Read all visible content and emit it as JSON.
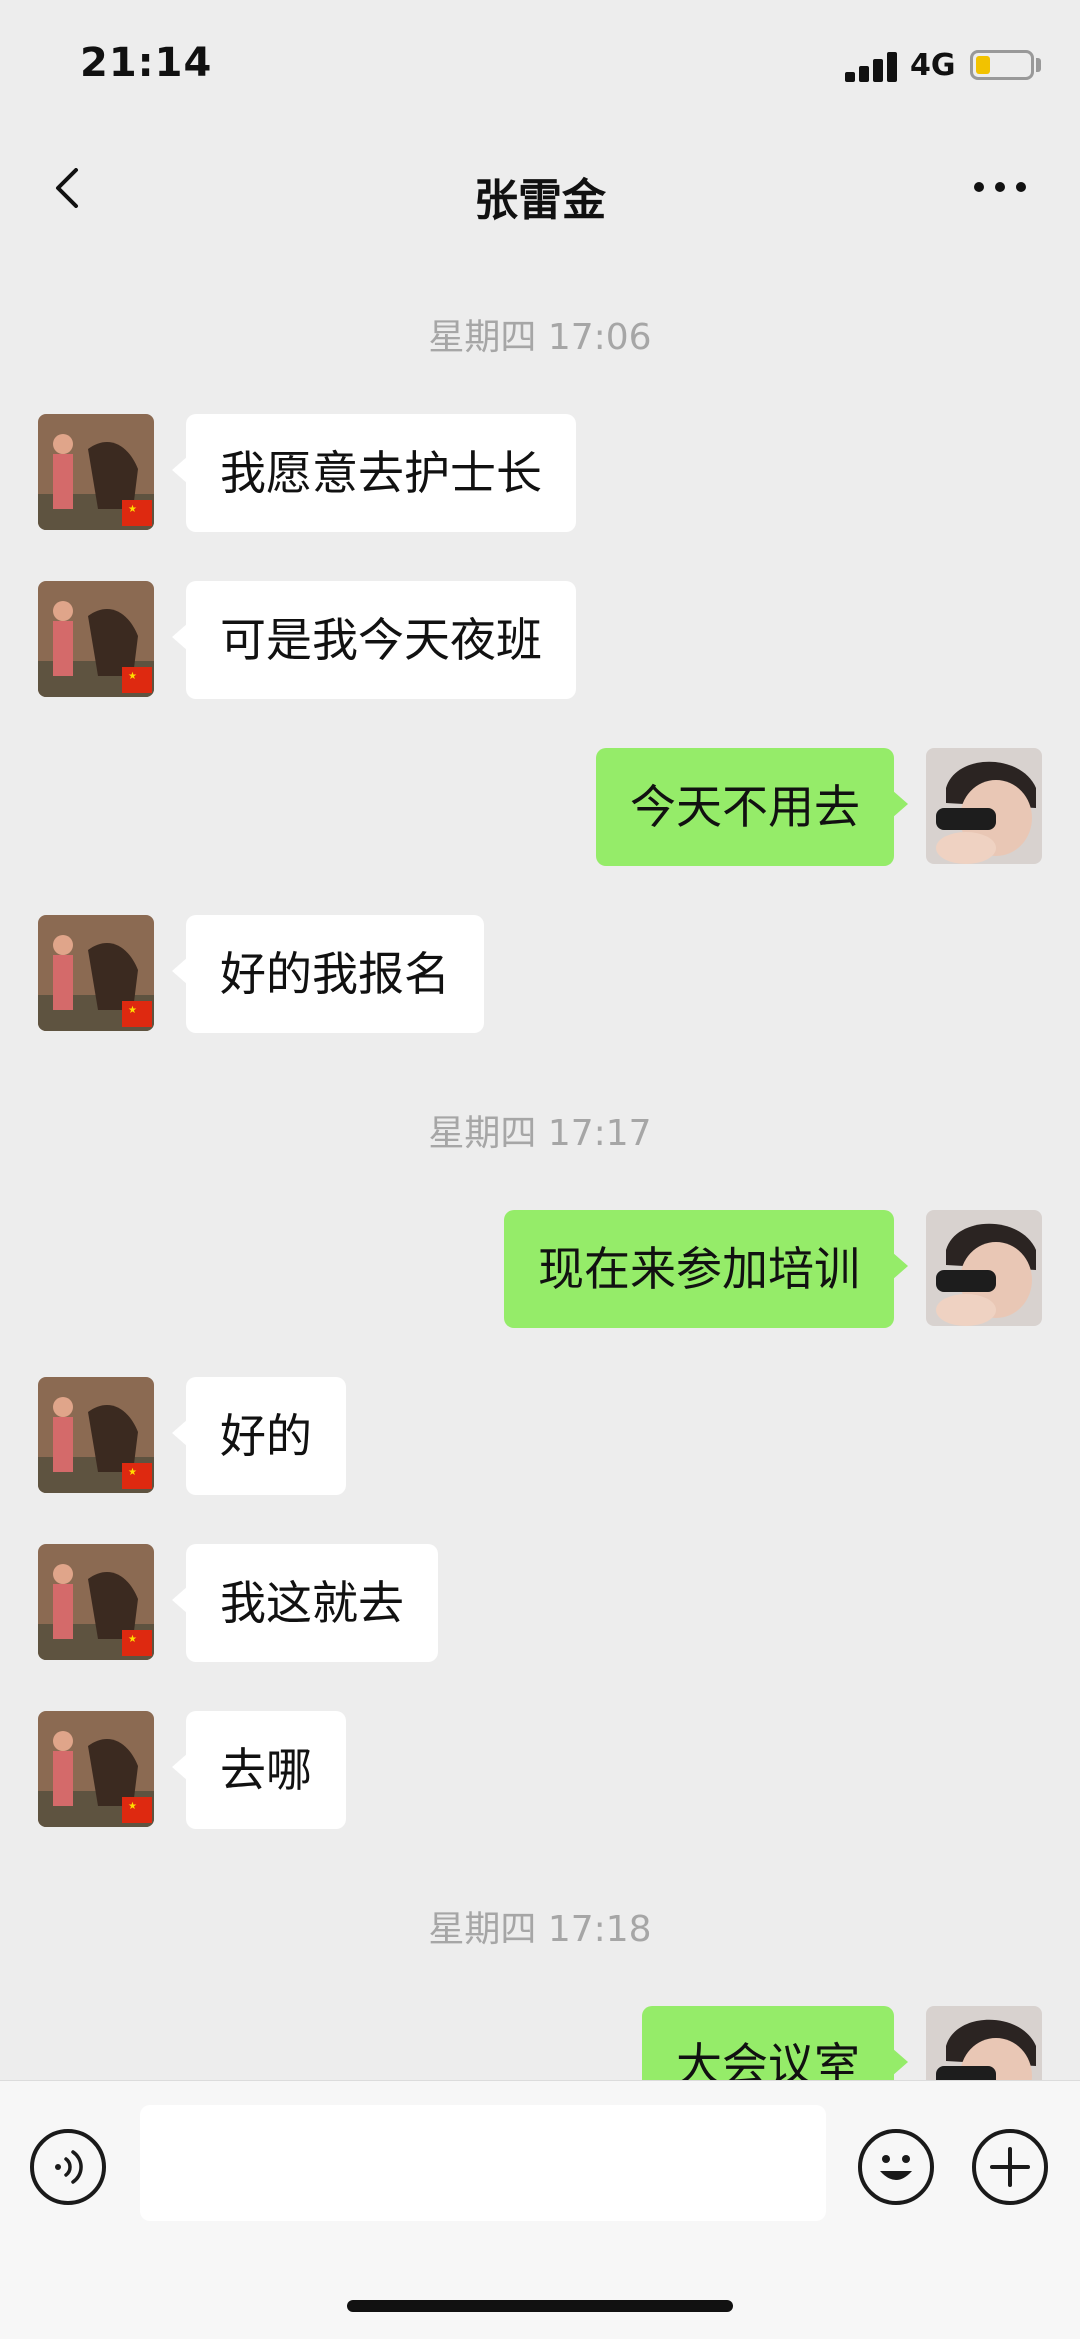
{
  "status_bar": {
    "time": "21:14",
    "network": "4G",
    "battery_color": "#f2c200"
  },
  "nav": {
    "title": "张雷金",
    "back_icon": "chevron-left-icon",
    "more_icon": "more-dots-icon"
  },
  "chat": {
    "timestamps": [
      "星期四 17:06",
      "星期四 17:17",
      "星期四 17:18"
    ],
    "messages": [
      {
        "sender": "contact",
        "text": "我愿意去护士长"
      },
      {
        "sender": "contact",
        "text": "可是我今天夜班"
      },
      {
        "sender": "self",
        "text": "今天不用去"
      },
      {
        "sender": "contact",
        "text": "好的我报名"
      },
      {
        "sender": "self",
        "text": "现在来参加培训"
      },
      {
        "sender": "contact",
        "text": "好的"
      },
      {
        "sender": "contact",
        "text": "我这就去"
      },
      {
        "sender": "contact",
        "text": "去哪"
      },
      {
        "sender": "self",
        "text": "大会议室"
      }
    ],
    "colors": {
      "incoming_bubble": "#ffffff",
      "outgoing_bubble": "#95ec69",
      "background": "#ededed",
      "timestamp": "#a6a6a6"
    }
  },
  "input_bar": {
    "voice_icon": "voice-wave-icon",
    "input_value": "",
    "emoji_icon": "smiley-icon",
    "plus_icon": "plus-icon"
  }
}
